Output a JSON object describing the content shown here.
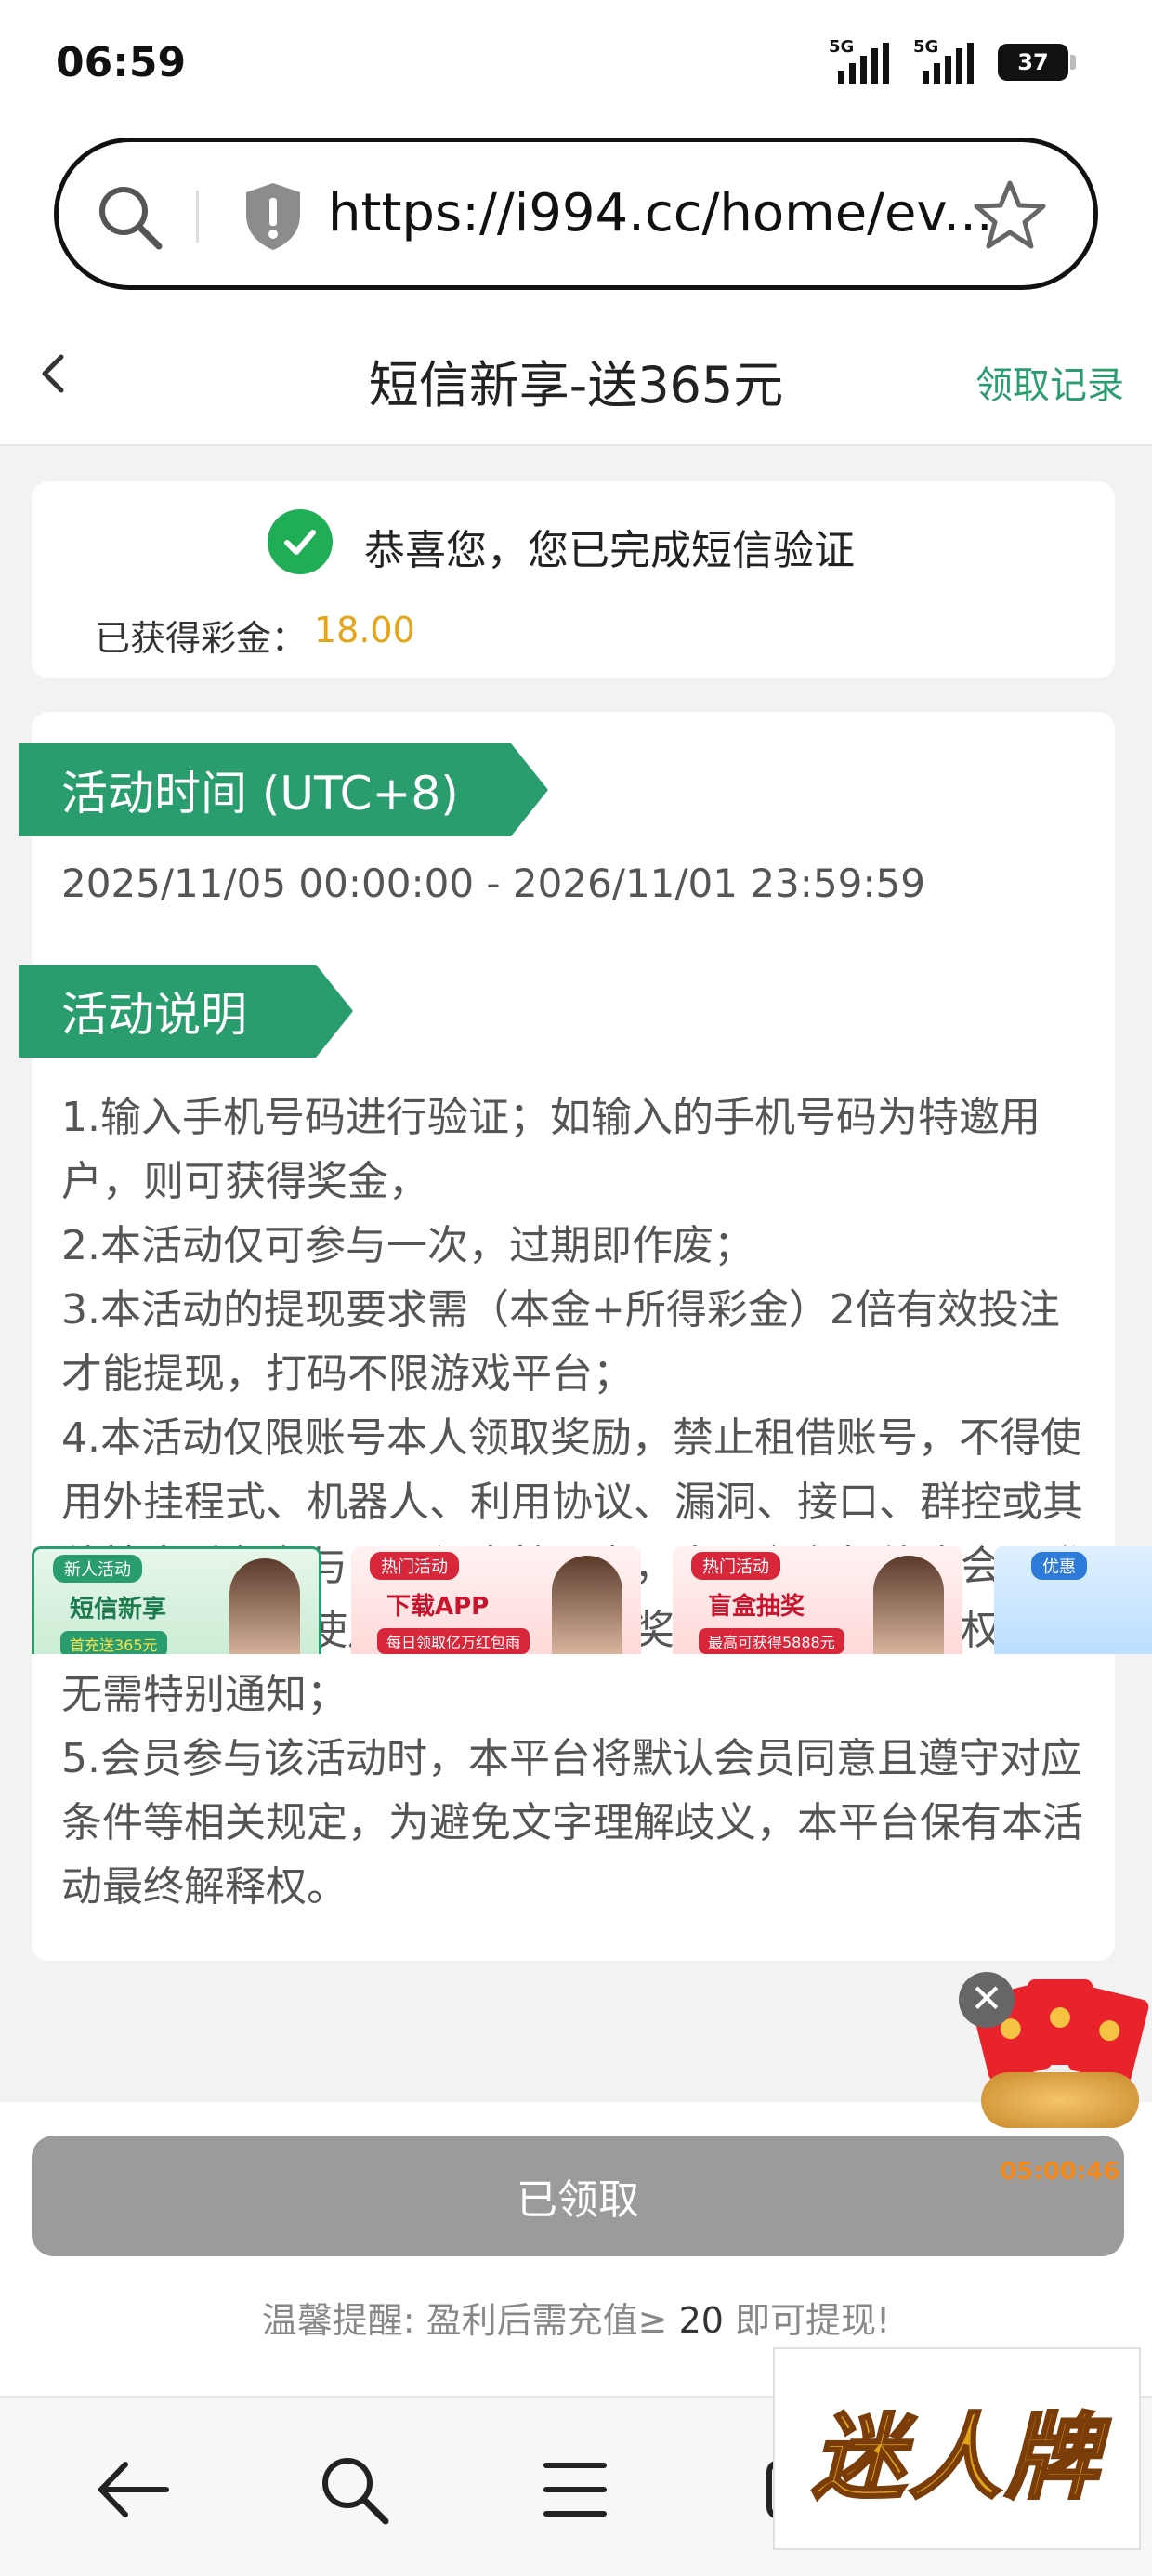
{
  "status_bar": {
    "time": "06:59",
    "signal1_label": "5G",
    "signal2_label": "5G",
    "battery": "37"
  },
  "browser": {
    "url": "https://i994.cc/home/ev..."
  },
  "header": {
    "title": "短信新享-送365元",
    "record_link": "领取记录"
  },
  "success_card": {
    "message": "恭喜您，您已完成短信验证",
    "bonus_label": "已获得彩金：",
    "bonus_value": "18.00"
  },
  "info_card": {
    "time_tag": "活动时间 (UTC+8)",
    "time_range": "2025/11/05 00:00:00 - 2026/11/01 23:59:59",
    "desc_tag": "活动说明",
    "rules": [
      "1.输入手机号码进行验证；如输入的手机号码为特邀用户，则可获得奖金，",
      "2.本活动仅可参与一次，过期即作废；",
      "3.本活动的提现要求需（本金+所得彩金）2倍有效投注才能提现，打码不限游戏平台；",
      "4.本活动仅限账号本人领取奖励，禁止租借账号，不得使用外挂程式、机器人、利用协议、漏洞、接口、群控或其他技术手段参与，一经查核属实，本平台有权终止会员登录、暂停会员使用网站、及没收奖金和不当盈利的权利，无需特别通知；",
      "5.会员参与该活动时，本平台将默认会员同意且遵守对应条件等相关规定，为避免文字理解歧义，本平台保有本活动最终解释权。"
    ]
  },
  "banners": [
    {
      "tag": "新人活动",
      "main": "短信新享",
      "sub": "首充送365元"
    },
    {
      "tag": "热门活动",
      "main": "下载APP",
      "sub": "每日领取亿万红包雨"
    },
    {
      "tag": "热门活动",
      "main": "盲盒抽奖",
      "sub": "最高可获得5888元"
    },
    {
      "tag": "优惠"
    }
  ],
  "float_widget": {
    "countdown": "05:00:46",
    "close_glyph": "✕"
  },
  "bottom": {
    "claim_button": "已领取",
    "reminder_prefix": "温馨提醒: 盈利后需充值≥ ",
    "reminder_amount": "20",
    "reminder_suffix": " 即可提现!"
  },
  "logo": {
    "text": "迷人牌"
  },
  "colors": {
    "accent_green": "#2a9d6e",
    "success_green": "#1fae55",
    "bonus_gold": "#e6a417",
    "disabled_button": "#9b9b9b",
    "countdown_orange": "#f3881a"
  },
  "icons": {
    "url_search": "search-icon",
    "security": "shield-icon",
    "bookmark": "star-icon",
    "back": "chevron-left-icon",
    "verified": "check-icon",
    "nav_back": "arrow-left-icon",
    "nav_search": "search-icon",
    "nav_menu": "menu-icon",
    "nav_tabs": "tabs-icon"
  }
}
